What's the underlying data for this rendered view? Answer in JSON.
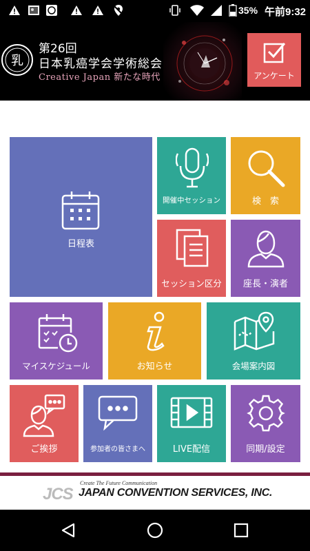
{
  "status_bar": {
    "battery": "35%",
    "time": "午前9:32"
  },
  "header": {
    "conference_number": "第26回",
    "conference_name": "日本乳癌学会学術総会",
    "theme": "Creative Japan 新たな時代",
    "survey_label": "アンケート"
  },
  "tiles": {
    "schedule": "日程表",
    "live_session": "開催中セッション",
    "search": "検　索",
    "session_category": "セッション区分",
    "chairs_speakers": "座長・演者",
    "my_schedule": "マイスケジュール",
    "news": "お知らせ",
    "venue_map": "会場案内図",
    "greeting": "ご挨拶",
    "to_participants": "参加者の皆さまへ",
    "live_stream": "LIVE配信",
    "sync_settings": "同期/設定"
  },
  "footer": {
    "logo_mark": "JCS",
    "tagline": "Create The Future Communication",
    "company": "JAPAN CONVENTION SERVICES, INC."
  },
  "colors": {
    "blue": "#6470b9",
    "teal": "#2ea795",
    "orange": "#eaa826",
    "red": "#e05d5d",
    "purple": "#8a5ab4",
    "brand_divider": "#7a1f40"
  },
  "icons": {
    "status_left": [
      "warning-icon",
      "image-icon",
      "app-icon",
      "warning-icon",
      "warning-icon",
      "location-off-icon"
    ],
    "status_right": [
      "vibrate-icon",
      "wifi-icon",
      "signal-icon",
      "battery-icon"
    ],
    "nav": [
      "back-icon",
      "home-icon",
      "recents-icon"
    ]
  }
}
